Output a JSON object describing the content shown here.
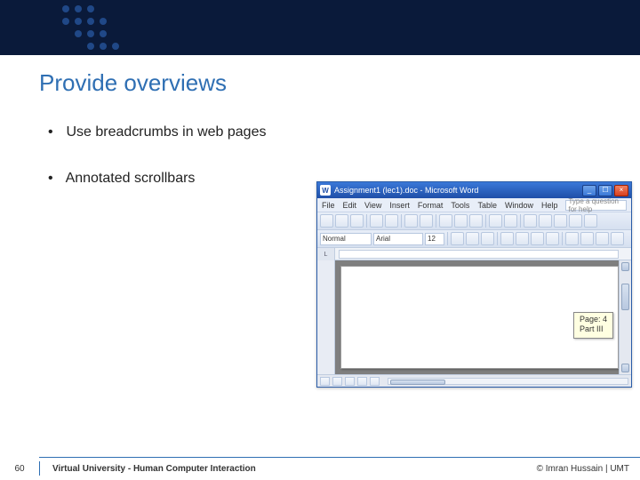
{
  "slide": {
    "title": "Provide overviews",
    "bullets": [
      "Use breadcrumbs in web pages",
      "Annotated scrollbars"
    ]
  },
  "word_window": {
    "title": "Assignment1 (lec1).doc - Microsoft Word",
    "menu": {
      "file": "File",
      "edit": "Edit",
      "view": "View",
      "insert": "Insert",
      "format": "Format",
      "tools": "Tools",
      "table": "Table",
      "window": "Window",
      "help": "Help",
      "help_placeholder": "Type a question for help"
    },
    "format_toolbar": {
      "style": "Normal",
      "font": "Arial",
      "size": "12"
    },
    "ruler_corner_label": "L",
    "scroll_tooltip": {
      "line1": "Page: 4",
      "line2": "Part III"
    }
  },
  "footer": {
    "page_number": "60",
    "course": "Virtual University - Human Computer Interaction",
    "copyright": "© Imran Hussain | UMT"
  }
}
